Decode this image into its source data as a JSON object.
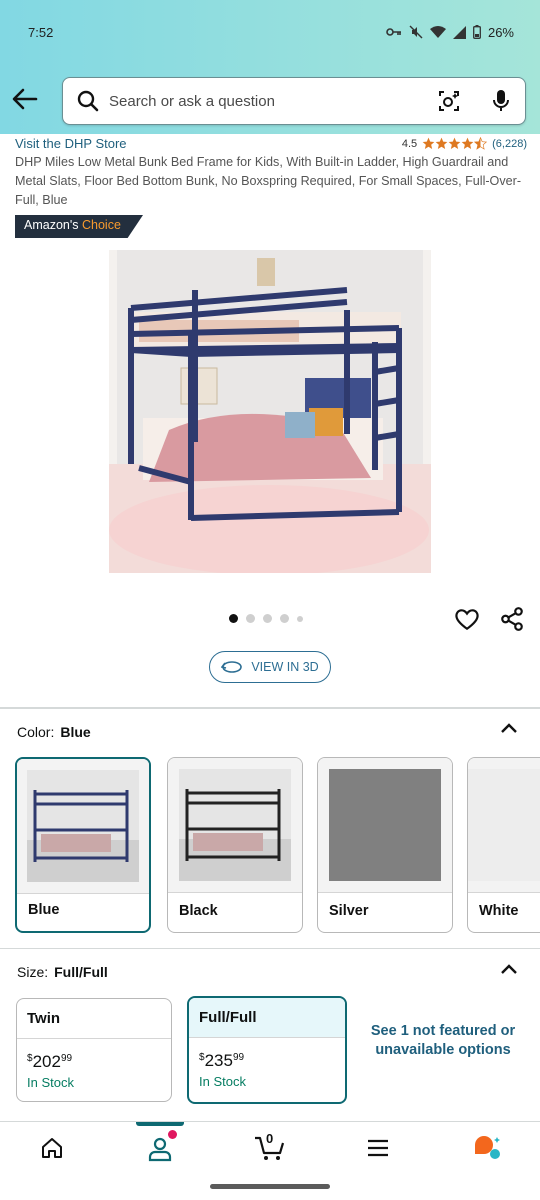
{
  "status_bar": {
    "time": "7:52",
    "battery": "26%"
  },
  "search": {
    "placeholder": "Search or ask a question"
  },
  "product": {
    "store_link": "Visit the DHP Store",
    "rating": "4.5",
    "rating_count": "(6,228)",
    "title": "DHP Miles Low Metal Bunk Bed Frame for Kids, With Built-in Ladder, High Guardrail and Metal Slats, Floor Bed Bottom Bunk, No Boxspring Required, For Small Spaces, Full-Over-Full, Blue",
    "badge_prefix": "Amazon's",
    "badge_choice": "Choice",
    "image_count": 5,
    "active_image": 1,
    "view_3d_label": "VIEW IN 3D"
  },
  "color": {
    "label": "Color:",
    "selected": "Blue",
    "options": [
      {
        "name": "Blue"
      },
      {
        "name": "Black"
      },
      {
        "name": "Silver"
      },
      {
        "name": "White"
      }
    ]
  },
  "size": {
    "label": "Size:",
    "selected": "Full/Full",
    "options": [
      {
        "name": "Twin",
        "price_dollars": "202",
        "price_cents": "99",
        "stock": "In Stock"
      },
      {
        "name": "Full/Full",
        "price_dollars": "235",
        "price_cents": "99",
        "stock": "In Stock"
      }
    ],
    "unavailable_link": "See 1 not featured or unavailable options"
  },
  "bottom_nav": {
    "items": [
      "home-icon",
      "account-icon",
      "cart-icon",
      "menu-icon",
      "rufus-icon"
    ],
    "cart_count": "0"
  },
  "colors": {
    "header_gradient_start": "#82d8e3",
    "header_gradient_end": "#a5e5d9",
    "accent_teal": "#0e6972",
    "link_blue": "#1f5f7d",
    "star_orange": "#de7921",
    "in_stock_green": "#067d62"
  }
}
